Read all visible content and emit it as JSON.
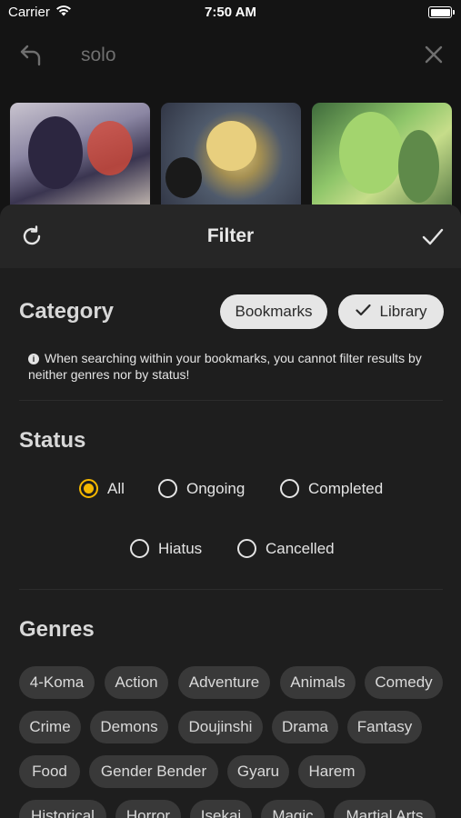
{
  "status_bar": {
    "carrier": "Carrier",
    "time": "7:50 AM"
  },
  "search": {
    "query": "solo",
    "back_icon": "undo-arrow-icon",
    "clear_icon": "close-icon"
  },
  "results": {
    "thumbnails": [
      "manga-cover-1",
      "manga-cover-2",
      "manga-cover-3"
    ]
  },
  "filter": {
    "title": "Filter",
    "reset_icon": "refresh-icon",
    "apply_icon": "checkmark-icon",
    "category": {
      "title": "Category",
      "options": [
        {
          "label": "Bookmarks",
          "selected": false
        },
        {
          "label": "Library",
          "selected": true
        }
      ],
      "info": "When searching within your bookmarks, you cannot filter results by neither genres nor by status!"
    },
    "status": {
      "title": "Status",
      "options": [
        {
          "label": "All",
          "selected": true
        },
        {
          "label": "Ongoing",
          "selected": false
        },
        {
          "label": "Completed",
          "selected": false
        },
        {
          "label": "Hiatus",
          "selected": false
        },
        {
          "label": "Cancelled",
          "selected": false
        }
      ]
    },
    "genres": {
      "title": "Genres",
      "items": [
        "4-Koma",
        "Action",
        "Adventure",
        "Animals",
        "Comedy",
        "Crime",
        "Demons",
        "Doujinshi",
        "Drama",
        "Fantasy",
        "Food",
        "Gender Bender",
        "Gyaru",
        "Harem",
        "Historical",
        "Horror",
        "Isekai",
        "Magic",
        "Martial Arts"
      ]
    }
  },
  "colors": {
    "accent": "#f5b800",
    "background": "#1e1e1e",
    "chip": "#393939",
    "pill": "#e6e6e6"
  }
}
